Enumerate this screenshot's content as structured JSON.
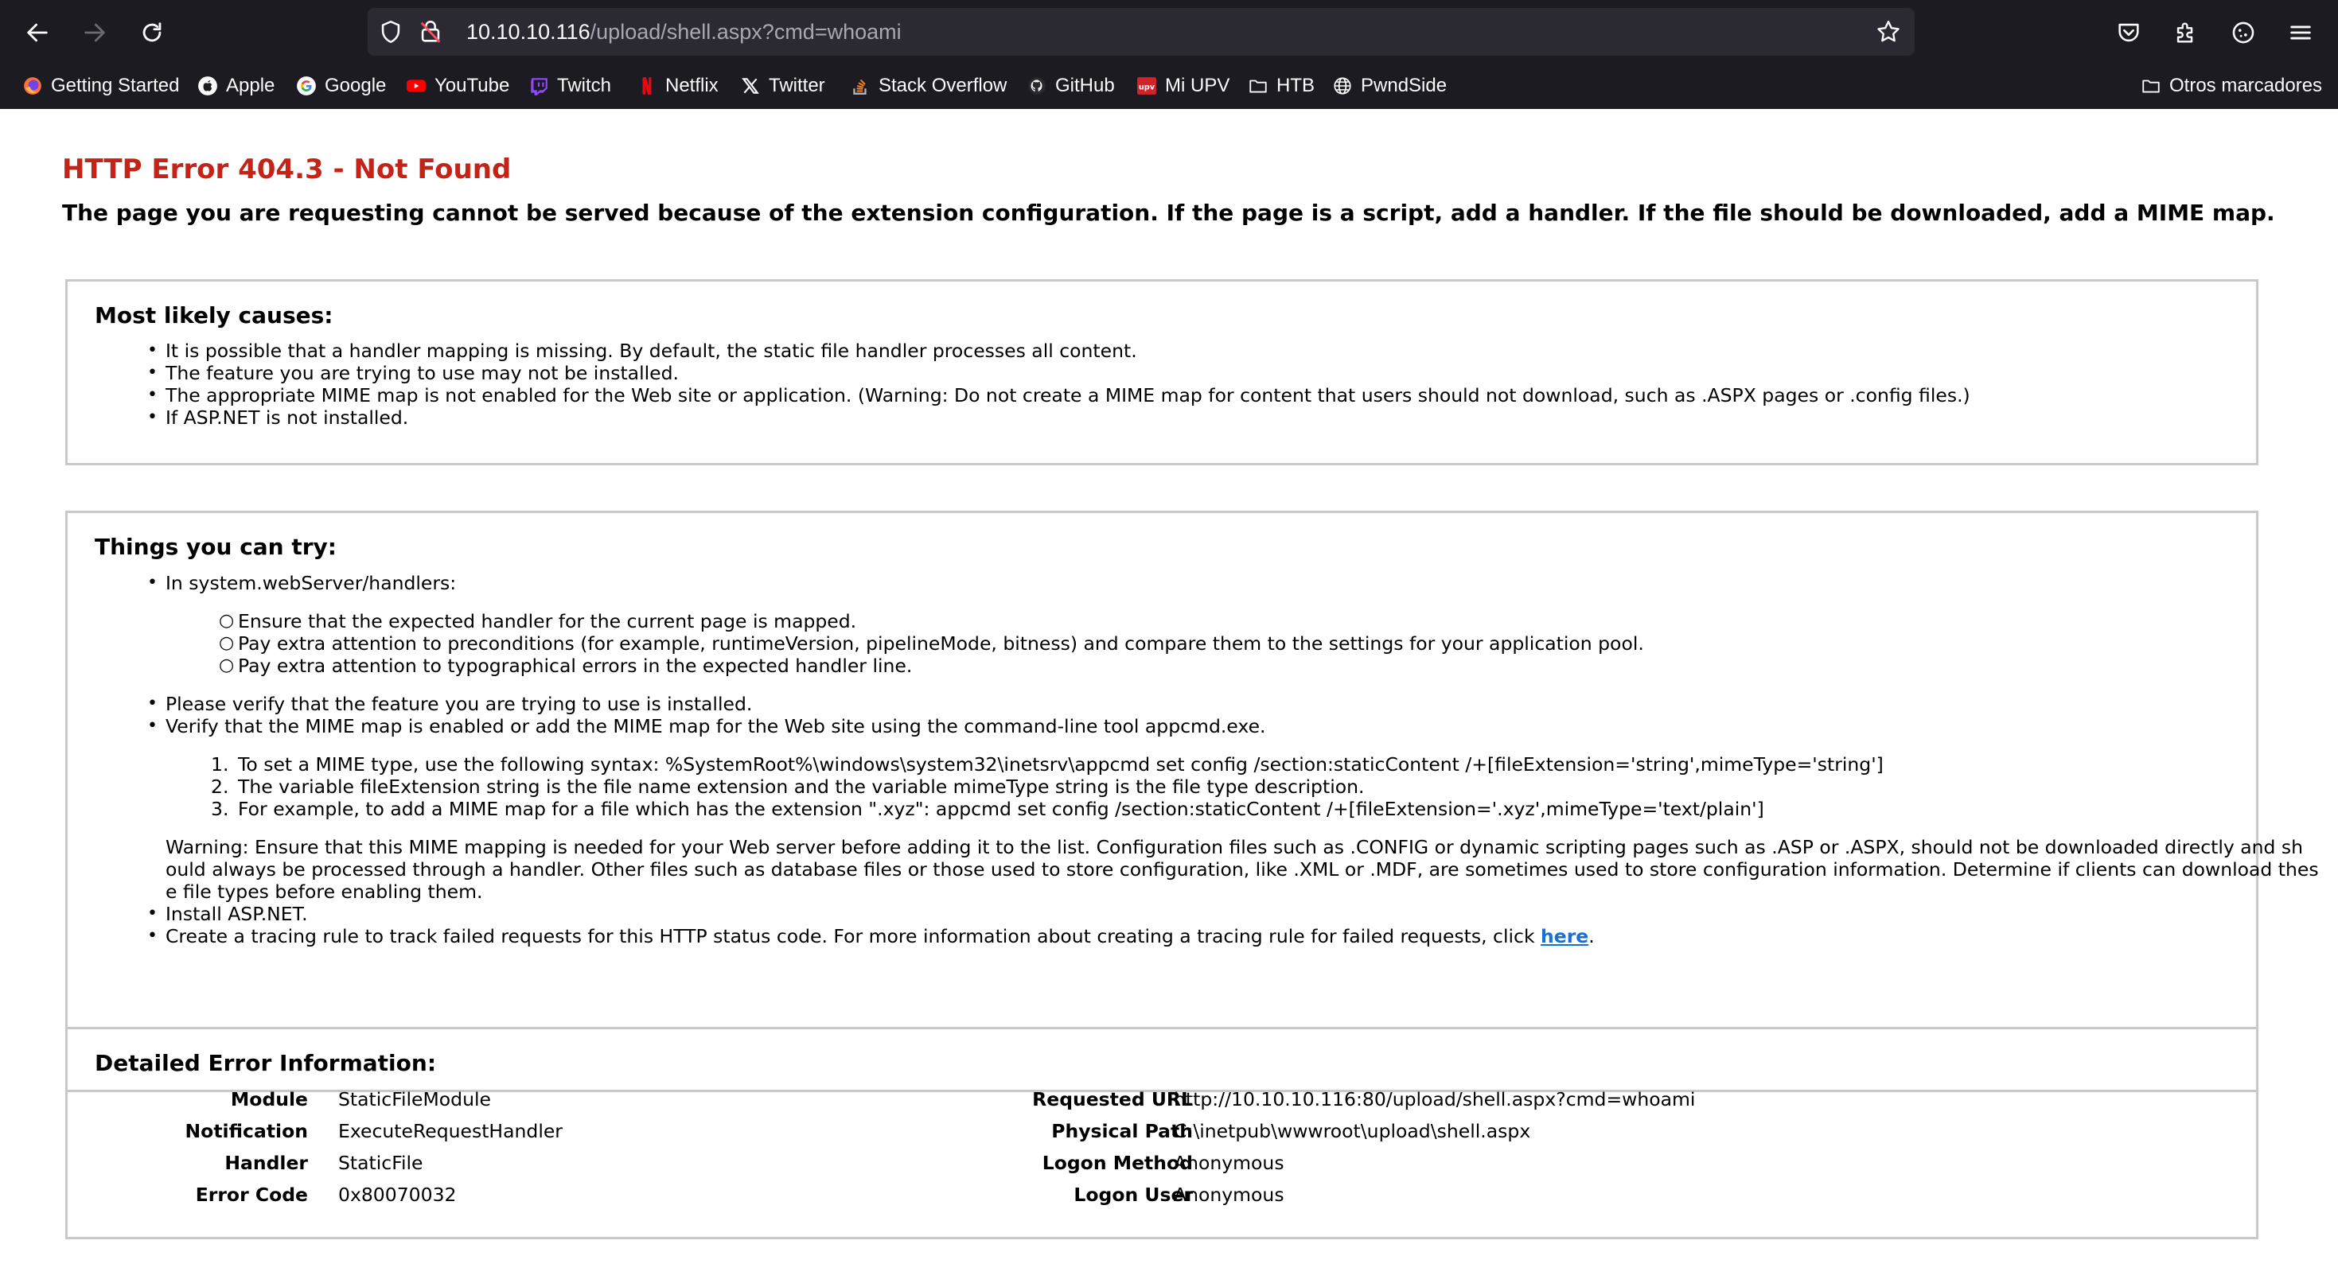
{
  "browser": {
    "url_host": "10.10.10.116",
    "url_path": "/upload/shell.aspx?cmd=whoami",
    "bookmarks": [
      {
        "label": "Getting Started",
        "icon": "firefox-icon"
      },
      {
        "label": "Apple",
        "icon": "apple-icon"
      },
      {
        "label": "Google",
        "icon": "google-icon"
      },
      {
        "label": "YouTube",
        "icon": "youtube-icon"
      },
      {
        "label": "Twitch",
        "icon": "twitch-icon"
      },
      {
        "label": "Netflix",
        "icon": "netflix-icon"
      },
      {
        "label": "Twitter",
        "icon": "x-icon"
      },
      {
        "label": "Stack Overflow",
        "icon": "stackoverflow-icon"
      },
      {
        "label": "GitHub",
        "icon": "github-icon"
      },
      {
        "label": "Mi UPV",
        "icon": "upv-icon"
      },
      {
        "label": "HTB",
        "icon": "folder-icon"
      },
      {
        "label": "PwndSide",
        "icon": "globe-icon"
      }
    ],
    "other_bookmarks": "Otros marcadores",
    "colors": {
      "chrome": "#1c1b22",
      "urlbar": "#2b2a33",
      "error_red": "#c42318",
      "link": "#1a6fd6"
    }
  },
  "page": {
    "title": "HTTP Error 404.3 - Not Found",
    "description": "The page you are requesting cannot be served because of the extension configuration. If the page is a script, add a handler. If the file should be downloaded, add a MIME map.",
    "causes": {
      "heading": "Most likely causes:",
      "items": [
        "It is possible that a handler mapping is missing. By default, the static file handler processes all content.",
        "The feature you are trying to use may not be installed.",
        "The appropriate MIME map is not enabled for the Web site or application. (Warning: Do not create a MIME map for content that users should not download, such as .ASPX pages or .config files.)",
        "If ASP.NET is not installed."
      ]
    },
    "try": {
      "heading": "Things you can try:",
      "item1": "In system.webServer/handlers:",
      "sub": [
        "Ensure that the expected handler for the current page is mapped.",
        "Pay extra attention to preconditions (for example, runtimeVersion, pipelineMode, bitness) and compare them to the settings for your application pool.",
        "Pay extra attention to typographical errors in the expected handler line."
      ],
      "item2": "Please verify that the feature you are trying to use is installed.",
      "item3": "Verify that the MIME map is enabled or add the MIME map for the Web site using the command-line tool appcmd.exe.",
      "numbered": [
        "To set a MIME type, use the following syntax: %SystemRoot%\\windows\\system32\\inetsrv\\appcmd set config /section:staticContent /+[fileExtension='string',mimeType='string']",
        "The variable fileExtension string is the file name extension and the variable mimeType string is the file type description.",
        "For example, to add a MIME map for a file which has the extension \".xyz\": appcmd set config /section:staticContent /+[fileExtension='.xyz',mimeType='text/plain']"
      ],
      "warning_lines": [
        "Warning: Ensure that this MIME mapping is needed for your Web server before adding it to the list. Configuration files such as .CONFIG or dynamic scripting pages such as .ASP or .ASPX, should not be downloaded directly and sh",
        "ould always be processed through a handler. Other files such as database files or those used to store configuration, like .XML or .MDF, are sometimes used to store configuration information. Determine if clients can download thes",
        "e file types before enabling them."
      ],
      "item4": "Install ASP.NET.",
      "item5": "Create a tracing rule to track failed requests for this HTTP status code. For more information about creating a tracing rule for failed requests, click ",
      "link": "here",
      "after_link": "."
    },
    "details": {
      "heading": "Detailed Error Information:",
      "left": [
        {
          "label": "Module",
          "value": "StaticFileModule"
        },
        {
          "label": "Notification",
          "value": "ExecuteRequestHandler"
        },
        {
          "label": "Handler",
          "value": "StaticFile"
        },
        {
          "label": "Error Code",
          "value": "0x80070032"
        }
      ],
      "right": [
        {
          "label": "Requested URL",
          "value": "http://10.10.10.116:80/upload/shell.aspx?cmd=whoami"
        },
        {
          "label": "Physical Path",
          "value": "C:\\inetpub\\wwwroot\\upload\\shell.aspx"
        },
        {
          "label": "Logon Method",
          "value": "Anonymous"
        },
        {
          "label": "Logon User",
          "value": "Anonymous"
        }
      ]
    }
  }
}
